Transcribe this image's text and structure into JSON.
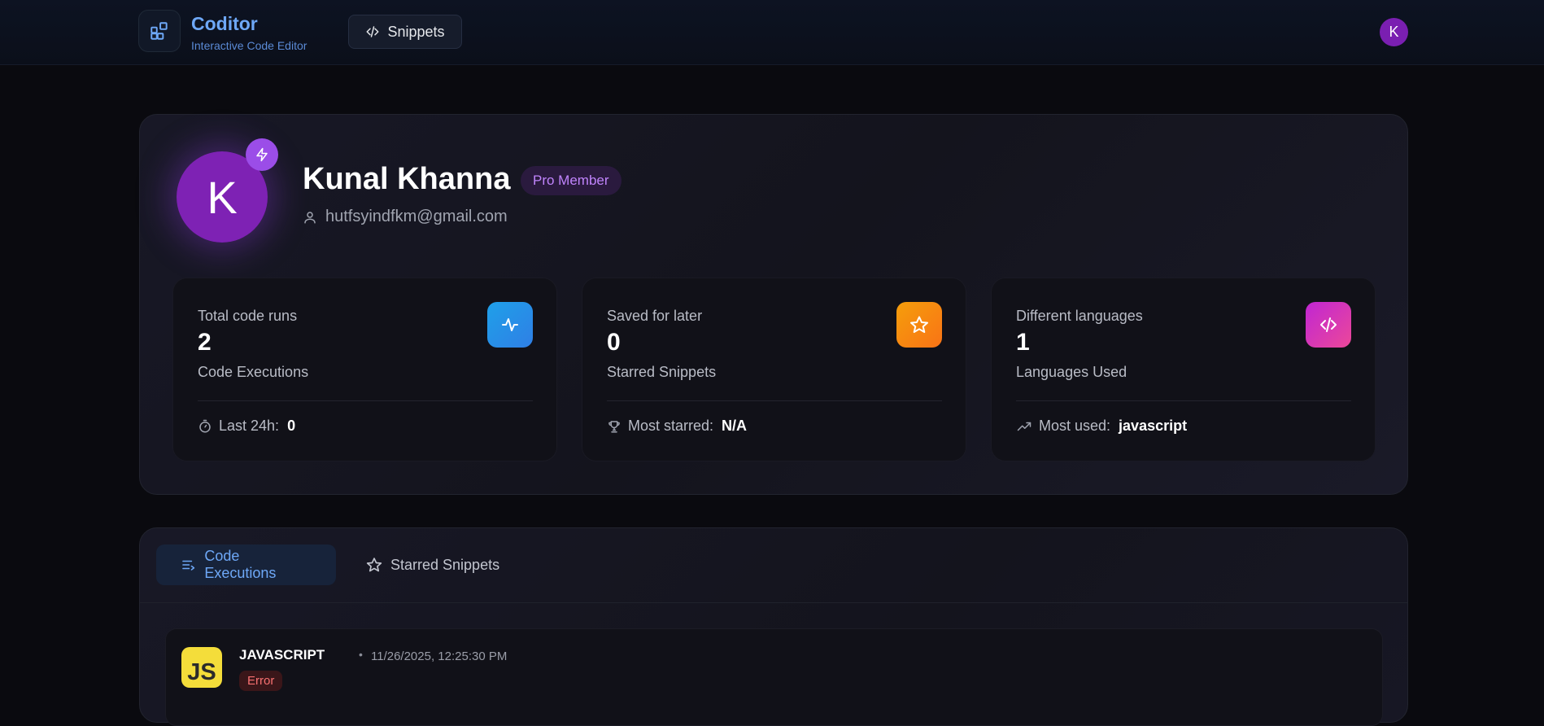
{
  "header": {
    "brand_name": "Coditor",
    "brand_subtitle": "Interactive Code Editor",
    "snippets_label": "Snippets",
    "avatar_letter": "K"
  },
  "profile": {
    "avatar_letter": "K",
    "name": "Kunal Khanna",
    "badge": "Pro Member",
    "email": "hutfsyindfkm@gmail.com"
  },
  "stats": [
    {
      "label": "Total code runs",
      "value": "2",
      "description": "Code Executions",
      "footer_label": "Last 24h:",
      "footer_value": "0",
      "icon": "activity-icon",
      "color": "#1fa0e8"
    },
    {
      "label": "Saved for later",
      "value": "0",
      "description": "Starred Snippets",
      "footer_label": "Most starred:",
      "footer_value": "N/A",
      "icon": "star-icon",
      "color": "#f59e0b"
    },
    {
      "label": "Different languages",
      "value": "1",
      "description": "Languages Used",
      "footer_label": "Most used:",
      "footer_value": "javascript",
      "icon": "code-icon",
      "color": "#d946ef"
    }
  ],
  "tabs": [
    {
      "label": "Code Executions",
      "active": true
    },
    {
      "label": "Starred Snippets",
      "active": false
    }
  ],
  "executions": [
    {
      "badge": "JS",
      "language": "JAVASCRIPT",
      "timestamp": "11/26/2025, 12:25:30 PM",
      "status": "Error"
    }
  ],
  "colors": {
    "accent": "#6ea8f7",
    "avatar": "#7e22b4",
    "pro": "#c084fc",
    "error": "#f87171"
  }
}
